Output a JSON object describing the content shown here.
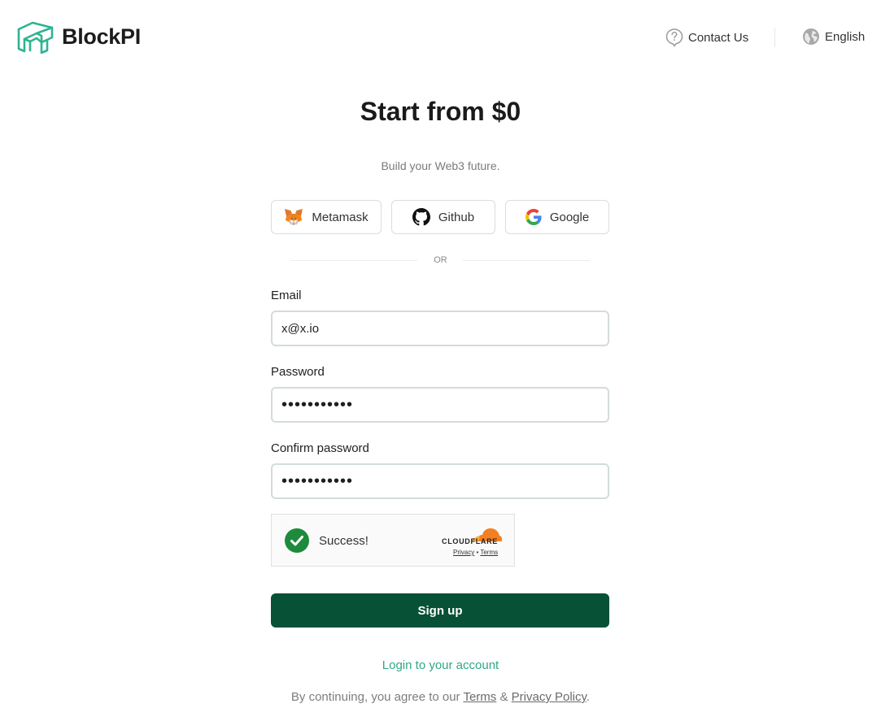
{
  "header": {
    "brand": "BlockPI",
    "contact_label": "Contact Us",
    "language_label": "English"
  },
  "main": {
    "title": "Start from $0",
    "subtitle": "Build your Web3 future.",
    "social": {
      "metamask": "Metamask",
      "github": "Github",
      "google": "Google"
    },
    "divider_text": "OR",
    "form": {
      "email_label": "Email",
      "email_value": "x@x.io",
      "password_label": "Password",
      "password_value": "•••••••••••",
      "confirm_label": "Confirm password",
      "confirm_value": "•••••••••••"
    },
    "captcha": {
      "status": "Success!",
      "provider": "CLOUDFLARE",
      "privacy": "Privacy",
      "separator": "•",
      "terms": "Terms"
    },
    "signup_label": "Sign up",
    "login_link": "Login to your account",
    "legal": {
      "prefix": "By continuing, you agree to our ",
      "terms": "Terms",
      "and": " & ",
      "privacy": "Privacy Policy",
      "suffix": "."
    }
  },
  "colors": {
    "brand_teal": "#2fb391",
    "primary_button": "#075137",
    "link": "#2fa886",
    "success_green": "#1e8a3c",
    "cloudflare_orange": "#f38020"
  },
  "icons": [
    "blockpi-logo-icon",
    "help-circle-icon",
    "globe-icon",
    "metamask-fox-icon",
    "github-icon",
    "google-icon",
    "check-circle-icon",
    "cloudflare-cloud-icon"
  ]
}
